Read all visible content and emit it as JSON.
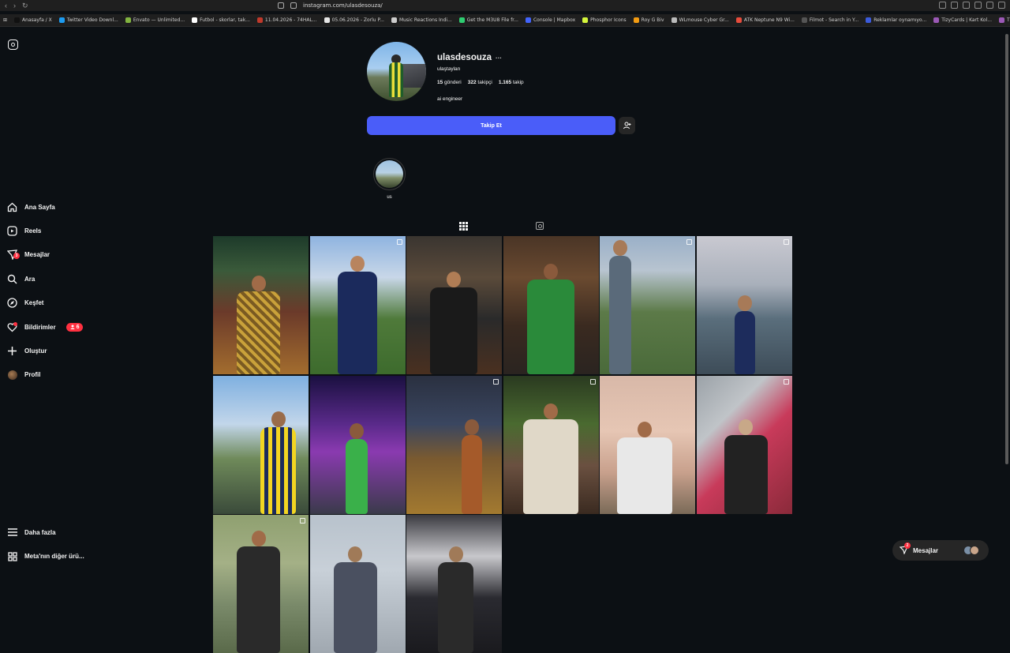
{
  "browser": {
    "url": "instagram.com/ulasdesouza/",
    "bookmarks": [
      {
        "label": "Anasayfa / X",
        "color": "#111111"
      },
      {
        "label": "Twitter Video Downl...",
        "color": "#1d9bf0"
      },
      {
        "label": "Envato — Unlimited...",
        "color": "#82b440"
      },
      {
        "label": "Futbol - skorlar, tak...",
        "color": "#ffffff"
      },
      {
        "label": "11.04.2026 - 74HAL...",
        "color": "#c0392b"
      },
      {
        "label": "05.06.2026 - Zorlu P...",
        "color": "#e6e6e6"
      },
      {
        "label": "Music Reactions Indi...",
        "color": "#cccccc"
      },
      {
        "label": "Get the M3U8 File fr...",
        "color": "#2ecc71"
      },
      {
        "label": "Console | Mapbox",
        "color": "#4264fb"
      },
      {
        "label": "Phosphor Icons",
        "color": "#d4f53b"
      },
      {
        "label": "Roy G Biv",
        "color": "#f39c12"
      },
      {
        "label": "WLmouse Cyber Gr...",
        "color": "#bbbbbb"
      },
      {
        "label": "ATK Neptune N9 Wi...",
        "color": "#e74c3c"
      },
      {
        "label": "Filmot - Search in Y...",
        "color": "#555555"
      },
      {
        "label": "Reklamlar oynamıyo...",
        "color": "#3b5bdb"
      },
      {
        "label": "TizyCards | Kart Kol...",
        "color": "#9b59b6"
      },
      {
        "label": "TizyCards | Kart Kol...",
        "color": "#9b59b6"
      }
    ]
  },
  "nav": {
    "items": [
      {
        "key": "home",
        "label": "Ana Sayfa"
      },
      {
        "key": "reels",
        "label": "Reels"
      },
      {
        "key": "messages",
        "label": "Mesajlar",
        "badge": "3"
      },
      {
        "key": "search",
        "label": "Ara"
      },
      {
        "key": "explore",
        "label": "Keşfet"
      },
      {
        "key": "notifications",
        "label": "Bildirimler",
        "badge": "6"
      },
      {
        "key": "create",
        "label": "Oluştur"
      },
      {
        "key": "profile",
        "label": "Profil"
      }
    ],
    "more_label": "Daha fazla",
    "meta_label": "Meta'nın diğer ürü..."
  },
  "profile": {
    "username": "ulasdesouza",
    "more_glyph": "···",
    "full_name": "ulaştaylan",
    "posts_count": "15",
    "posts_label": "gönderi",
    "followers_count": "322",
    "followers_label": "takipçi",
    "following_count": "1.165",
    "following_label": "takip",
    "bio": "ai engineer",
    "follow_label": "Takip Et"
  },
  "highlights": [
    {
      "label": "us"
    }
  ],
  "messages_pill": {
    "label": "Mesajlar",
    "badge": "2"
  },
  "posts_visible": 15
}
